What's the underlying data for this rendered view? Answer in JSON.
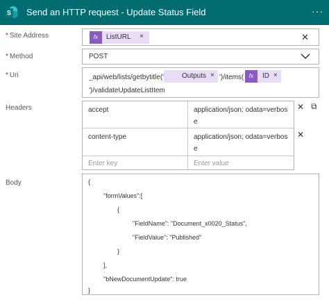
{
  "header": {
    "title": "Send an HTTP request - Update Status Field",
    "more_icon": "···",
    "bg_color": "#036c70"
  },
  "site_address": {
    "label": "Site Address",
    "required": "*",
    "token": {
      "icon": "fx",
      "text": "ListURL",
      "remove": "×"
    },
    "clear_icon": "✕"
  },
  "method": {
    "label": "Method",
    "required": "*",
    "value": "POST",
    "chevron": "⌵"
  },
  "uri": {
    "label": "Uri",
    "required": "*",
    "part1": "_api/web/lists/getbytitle('",
    "token1": {
      "text": "Outputs",
      "remove": "×"
    },
    "part2": "')/items(",
    "token2": {
      "icon": "fx",
      "text": "ID",
      "remove": "×"
    },
    "part3": "')/validateUpdateListItem"
  },
  "headers": {
    "label": "Headers",
    "rows": [
      {
        "key": "accept",
        "value_line1": "application/json; odata=verbos",
        "value_line2": "e"
      },
      {
        "key": "content-type",
        "value_line1": "application/json; odata=verbos",
        "value_line2": "e"
      }
    ],
    "key_placeholder": "Enter key",
    "value_placeholder": "Enter value",
    "delete_icon": "✕",
    "copy_icon": "⧉"
  },
  "body": {
    "label": "Body",
    "lines": [
      "{",
      "\"formValues\":[",
      "{",
      "\"FieldName\": \"Document_x0020_Status\",",
      "\"FieldValue\": \"Published\"",
      "}",
      "],",
      "\"bNewDocumentUpdate\": true",
      "}"
    ]
  }
}
